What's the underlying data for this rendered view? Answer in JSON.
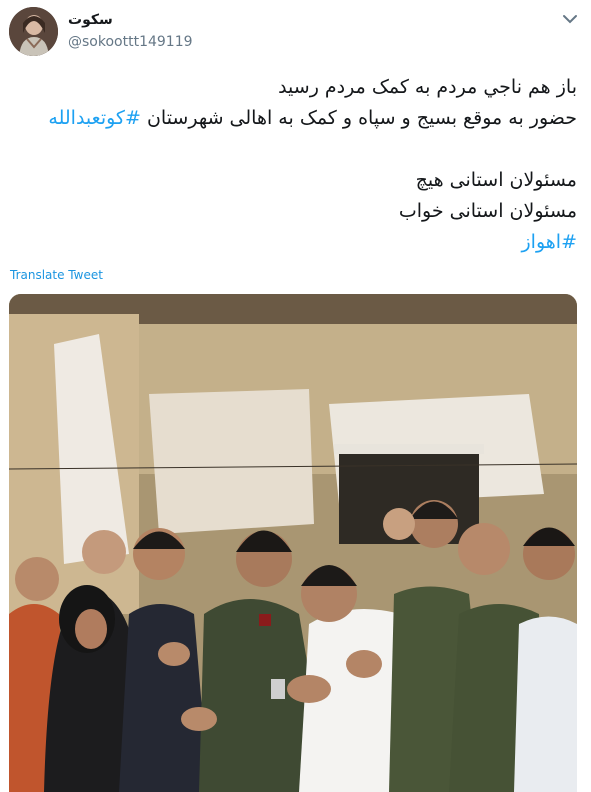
{
  "user": {
    "display_name": "سکوت",
    "handle": "@sokoottt149119"
  },
  "tweet": {
    "line1": "باز هم ناجي مردم به کمک مردم رسيد",
    "line2_text": "حضور به موقع بسیج و سپاه و کمک به اهالی شهرستان",
    "line2_hashtag": "#کوتعبدالله",
    "line3": "مسئولان استانی هیچ",
    "line4": "مسئولان استانی خواب",
    "line5_hashtag": "#اهواز"
  },
  "actions": {
    "translate_label": "Translate Tweet"
  },
  "icons": {
    "menu": "chevron-down-icon"
  },
  "colors": {
    "link": "#1da1f2",
    "handle": "#657786",
    "text": "#14171a"
  }
}
